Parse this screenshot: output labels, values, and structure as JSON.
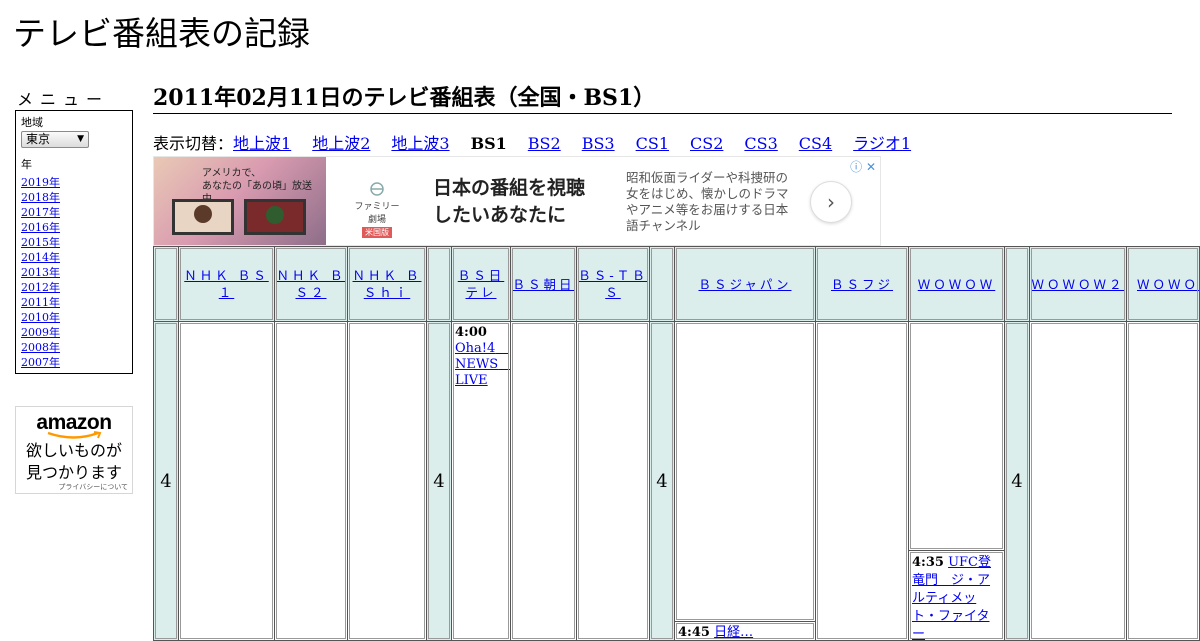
{
  "site": {
    "title": "テレビ番組表の記録"
  },
  "menu": {
    "heading": "メニュー",
    "region_label": "地域",
    "region_value": "東京",
    "year_label": "年",
    "years": [
      "2019年",
      "2018年",
      "2017年",
      "2016年",
      "2015年",
      "2014年",
      "2013年",
      "2012年",
      "2011年",
      "2010年",
      "2009年",
      "2008年",
      "2007年"
    ]
  },
  "amazon_ad": {
    "logo": "amazon",
    "tagline1": "欲しいものが",
    "tagline2": "見つかります",
    "privacy": "プライバシーについて"
  },
  "page": {
    "heading": "2011年02月11日のテレビ番組表（全国・BS1）"
  },
  "switcher": {
    "label": "表示切替：",
    "items": [
      {
        "label": "地上波1",
        "current": false
      },
      {
        "label": "地上波2",
        "current": false
      },
      {
        "label": "地上波3",
        "current": false
      },
      {
        "label": "BS1",
        "current": true
      },
      {
        "label": "BS2",
        "current": false
      },
      {
        "label": "BS3",
        "current": false
      },
      {
        "label": "CS1",
        "current": false
      },
      {
        "label": "CS2",
        "current": false
      },
      {
        "label": "CS3",
        "current": false
      },
      {
        "label": "CS4",
        "current": false
      },
      {
        "label": "ラジオ1",
        "current": false
      }
    ]
  },
  "banner": {
    "image_caption1": "アメリカで、",
    "image_caption2": "あなたの「あの頃」放送中。",
    "logo_name": "ファミリー劇場",
    "logo_badge": "米国版",
    "headline1": "日本の番組を視聴",
    "headline2": "したいあなたに",
    "description": "昭和仮面ライダーや科捜研の女をはじめ、懐かしのドラマやアニメ等をお届けする日本語チャンネル",
    "adchoices": "ⓘ ✕",
    "next_icon": "chevron-right-icon"
  },
  "grid": {
    "hour": "4",
    "channels": [
      "ＮＨＫ ＢＳ１",
      "ＮＨＫ ＢＳ２",
      "ＮＨＫ ＢＳｈｉ",
      "ＢＳ日テレ",
      "ＢＳ朝日",
      "ＢＳ-ＴＢＳ",
      "ＢＳジャパン",
      "ＢＳフジ",
      "ＷＯＷＯＷ",
      "ＷＯＷＯＷ２",
      "ＷＯＷＯＷ"
    ],
    "programs": [
      {
        "channel": "ＢＳ日テレ",
        "time": "4:00",
        "title": "Oha!4　NEWS　LIVE"
      },
      {
        "channel": "ＷＯＷＯＷ",
        "time": "4:35",
        "title": "UFC登竜門　ジ・アルティメット・ファイター"
      },
      {
        "channel": "ＢＳジャパン",
        "time": "4:45",
        "title": "日経…"
      }
    ]
  }
}
